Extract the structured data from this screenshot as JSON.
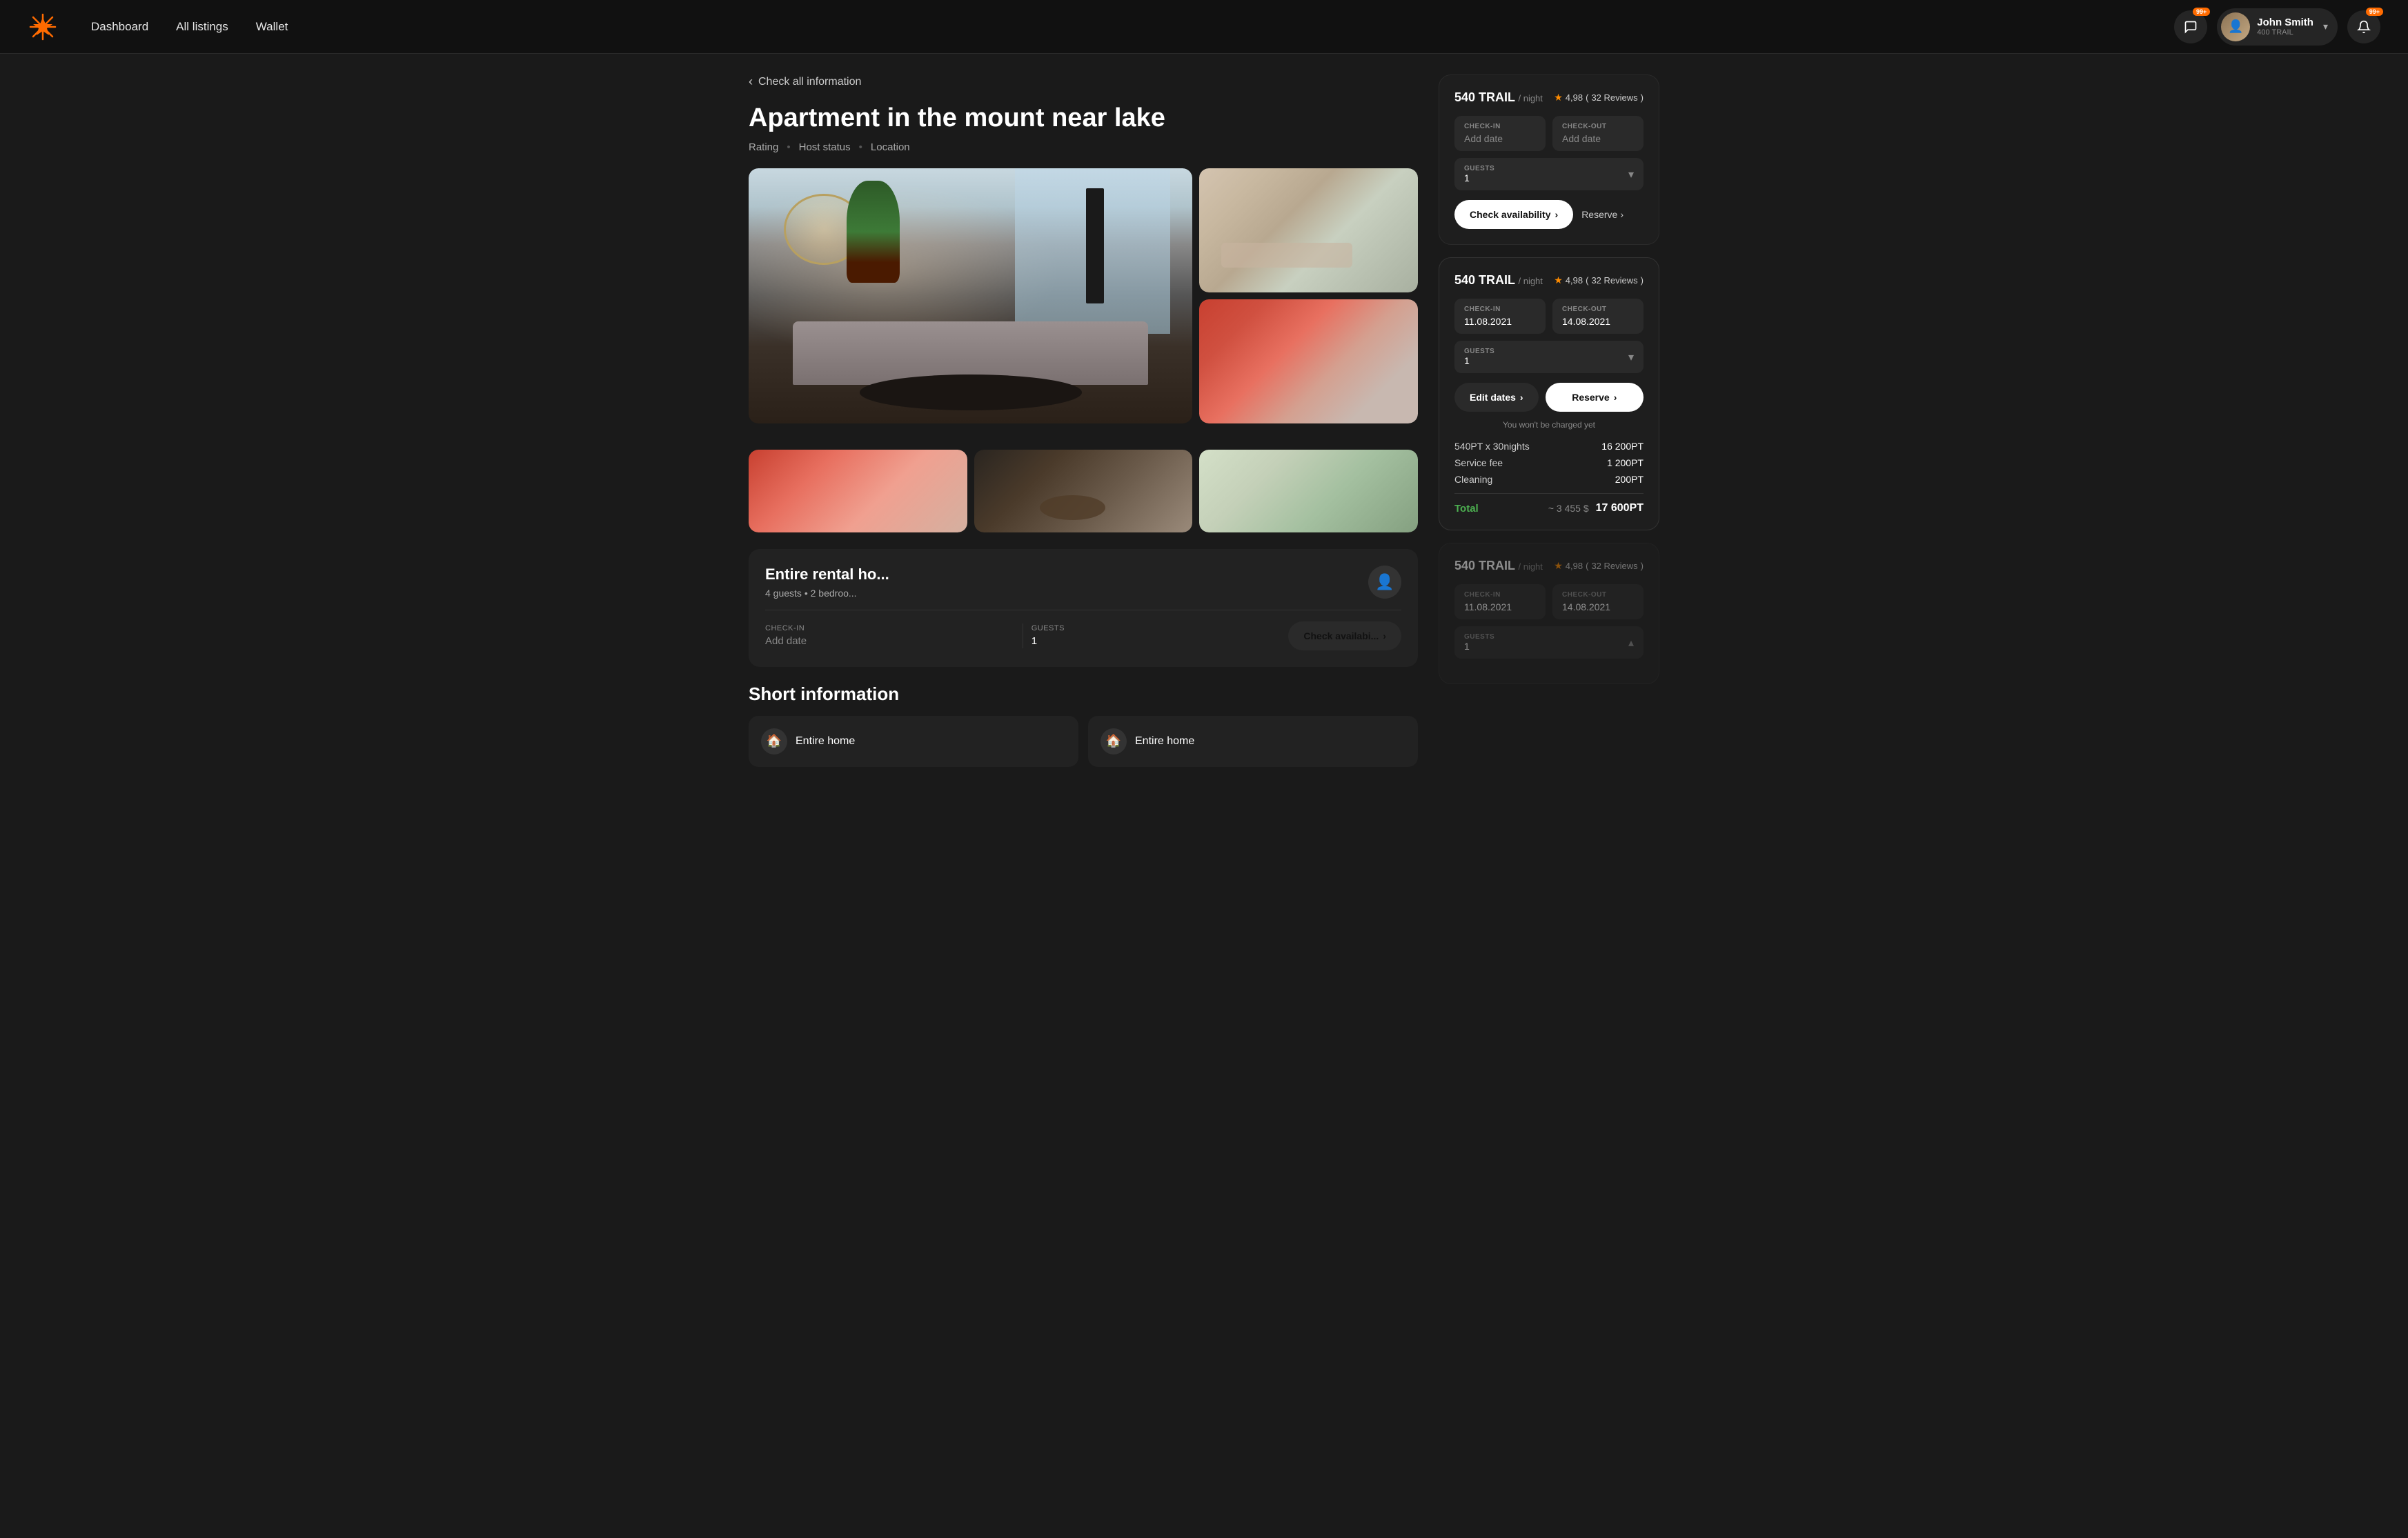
{
  "nav": {
    "logo_text": "✳",
    "links": [
      "Dashboard",
      "All listings",
      "Wallet"
    ],
    "chat_badge": "99+",
    "notification_badge": "99+",
    "user": {
      "name": "John Smith",
      "trail": "400 TRAIL"
    }
  },
  "breadcrumb": {
    "label": "Check all information"
  },
  "listing": {
    "title": "Apartment in the mount near lake",
    "meta": {
      "rating": "Rating",
      "host_status": "Host status",
      "location": "Location"
    },
    "rental_type": "Entire rental ho...",
    "guests": "4 guests",
    "bedrooms": "2 bedroo...",
    "short_info_title": "Short information",
    "short_info_cards": [
      {
        "icon": "🏠",
        "label": "Entire home"
      },
      {
        "icon": "🏠",
        "label": "Entire home"
      }
    ]
  },
  "booking_cards": [
    {
      "id": "card1",
      "state": "empty",
      "price": "540 TRAIL",
      "price_suffix": "/ night",
      "rating": "4,98",
      "reviews": "32 Reviews",
      "checkin_label": "CHECK-IN",
      "checkin_value": "Add date",
      "checkout_label": "CHECK-OUT",
      "checkout_value": "Add date",
      "guests_label": "GUESTS",
      "guests_value": "1",
      "check_btn": "Check availability",
      "reserve_btn": "Reserve"
    },
    {
      "id": "card2",
      "state": "expanded",
      "price": "540 TRAIL",
      "price_suffix": "/ night",
      "rating": "4,98",
      "reviews": "32 Reviews",
      "checkin_label": "CHECK-IN",
      "checkin_value": "11.08.2021",
      "checkout_label": "CHECK-OUT",
      "checkout_value": "14.08.2021",
      "guests_label": "GUESTS",
      "guests_value": "1",
      "edit_btn": "Edit dates",
      "reserve_btn": "Reserve",
      "no_charge_note": "You won't be charged yet",
      "cost_items": [
        {
          "label": "540PT x 30nights",
          "value": "16 200PT"
        },
        {
          "label": "Service fee",
          "value": "1 200PT"
        },
        {
          "label": "Cleaning",
          "value": "200PT"
        }
      ],
      "total_label": "Total",
      "total_approx": "~ 3 455 $",
      "total_value": "17 600PT"
    },
    {
      "id": "card3",
      "state": "collapsed",
      "price": "540 TRAIL",
      "price_suffix": "/ night",
      "rating": "4,98",
      "reviews": "32 Reviews",
      "checkin_label": "CHECK-IN",
      "checkin_value": "11.08.2021",
      "checkout_label": "CHECK-OUT",
      "checkout_value": "14.08.2021",
      "guests_label": "GUESTS",
      "guests_value": "1"
    }
  ]
}
